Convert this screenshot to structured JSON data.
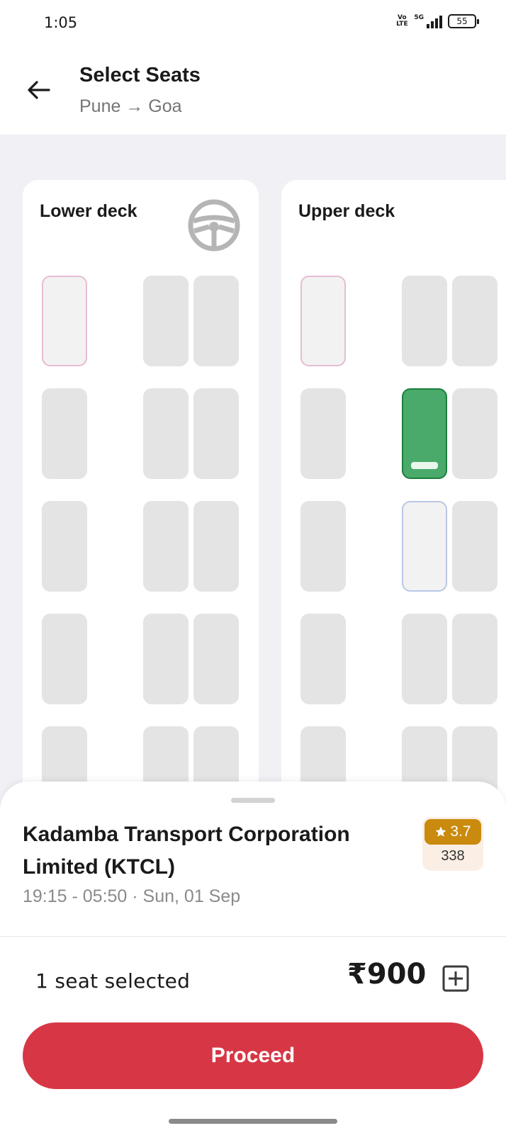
{
  "status_bar": {
    "time": "1:05",
    "volte_top": "Vo",
    "volte_bottom": "LTE",
    "network": "5G",
    "battery": "55"
  },
  "header": {
    "title": "Select Seats",
    "route": "Pune → Goa",
    "back_icon": "arrow-left-icon"
  },
  "decks": {
    "lower": {
      "title": "Lower deck",
      "icon": "steering-wheel-icon"
    },
    "upper": {
      "title": "Upper deck"
    }
  },
  "seat_legend_colors": {
    "available": "#e4e4e4",
    "ladies": "#e7bcd4",
    "gents": "#b9c7e6",
    "selected": "#4aaa6b"
  },
  "operator": {
    "name": "Kadamba Transport Corporation Limited  (KTCL)",
    "schedule": "19:15 - 05:50 · Sun, 01 Sep",
    "rating": "3.7",
    "rating_count": "338",
    "rating_icon": "star-icon"
  },
  "footer": {
    "seats_selected": "1 seat selected",
    "price": "₹900",
    "fare_icon": "plus-square-icon",
    "proceed_label": "Proceed"
  },
  "colors": {
    "accent": "#d73745",
    "rating": "#c98a0d"
  }
}
